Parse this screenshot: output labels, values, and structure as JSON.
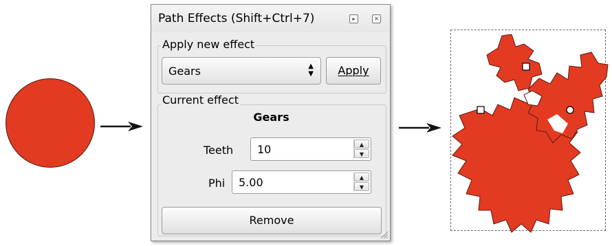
{
  "dialog": {
    "title": "Path Effects (Shift+Ctrl+7)",
    "apply_section": {
      "label": "Apply new effect",
      "selected_effect": "Gears",
      "apply_button": "Apply"
    },
    "current_section": {
      "label": "Current effect",
      "effect_name": "Gears",
      "fields": [
        {
          "label": "Teeth",
          "value": "10"
        },
        {
          "label": "Phi",
          "value": "5.00"
        }
      ],
      "remove_button": "Remove"
    }
  },
  "colors": {
    "shape_fill": "#e33a22",
    "dialog_bg": "#ececec"
  },
  "icons": {
    "titlebar": [
      "dock-icon",
      "close-icon"
    ],
    "arrows": [
      "arrow-right-icon",
      "arrow-right-icon"
    ]
  }
}
